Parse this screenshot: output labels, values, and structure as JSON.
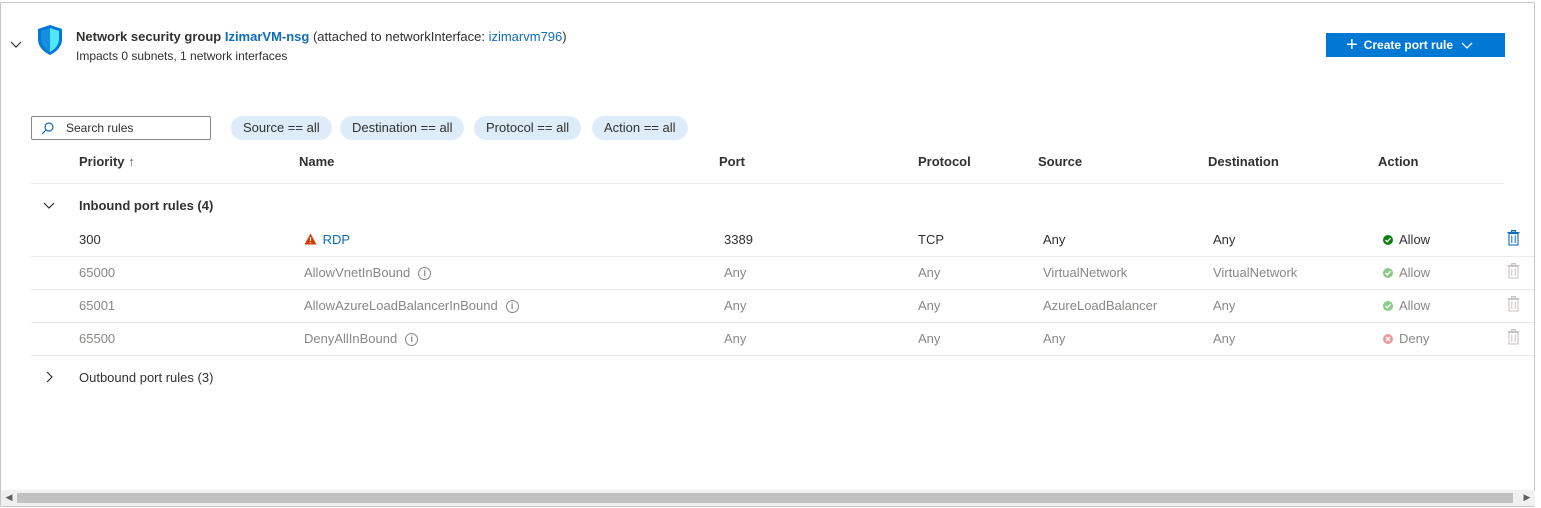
{
  "header": {
    "prefix": "Network security group",
    "nsg_name": "IzimarVM-nsg",
    "attached_prefix": "(attached to networkInterface: ",
    "nic_name": "izimarvm796",
    "attached_suffix": ")",
    "subtitle": "Impacts 0 subnets, 1 network interfaces",
    "create_label": "Create port rule"
  },
  "search": {
    "placeholder": "Search rules"
  },
  "filters": [
    "Source == all",
    "Destination == all",
    "Protocol == all",
    "Action == all"
  ],
  "columns": {
    "priority": "Priority",
    "name": "Name",
    "port": "Port",
    "protocol": "Protocol",
    "source": "Source",
    "destination": "Destination",
    "action": "Action"
  },
  "inbound": {
    "label": "Inbound port rules (4)",
    "rows": [
      {
        "priority": "300",
        "name": "RDP",
        "port": "3389",
        "protocol": "TCP",
        "source": "Any",
        "destination": "Any",
        "action": "Allow"
      },
      {
        "priority": "65000",
        "name": "AllowVnetInBound",
        "port": "Any",
        "protocol": "Any",
        "source": "VirtualNetwork",
        "destination": "VirtualNetwork",
        "action": "Allow"
      },
      {
        "priority": "65001",
        "name": "AllowAzureLoadBalancerInBound",
        "port": "Any",
        "protocol": "Any",
        "source": "AzureLoadBalancer",
        "destination": "Any",
        "action": "Allow"
      },
      {
        "priority": "65500",
        "name": "DenyAllInBound",
        "port": "Any",
        "protocol": "Any",
        "source": "Any",
        "destination": "Any",
        "action": "Deny"
      }
    ]
  },
  "outbound": {
    "label": "Outbound port rules (3)"
  },
  "colors": {
    "accent": "#0078d4",
    "link": "#0f6cbd",
    "allow": "#107c10",
    "deny": "#d13438",
    "warning": "#d83b01",
    "filter_pill": "#deecf9"
  },
  "icons": {
    "collapse": "chevron-down-icon",
    "nsg": "shield-icon",
    "create_plus": "plus-icon",
    "create_dropdown": "chevron-down-icon",
    "search": "search-icon",
    "inbound_toggle": "chevron-down-icon",
    "outbound_toggle": "chevron-right-icon",
    "rdp_warning": "warning-icon",
    "info": "info-icon",
    "allow": "check-circle-icon",
    "deny": "x-circle-icon",
    "delete": "trash-icon",
    "scroll_left": "arrow-left-icon",
    "scroll_right": "arrow-right-icon"
  }
}
